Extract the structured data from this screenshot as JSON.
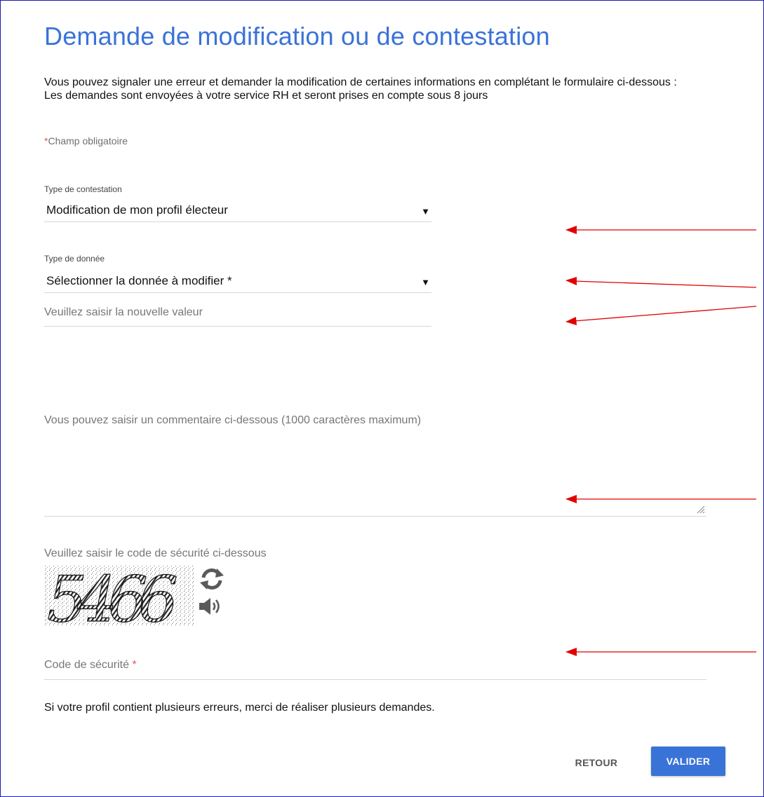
{
  "page": {
    "title": "Demande de modification ou de contestation",
    "intro_line1": "Vous pouvez signaler une erreur et demander la modification de certaines informations en complétant le formulaire ci-dessous :",
    "intro_line2": "Les demandes sont envoyées à votre service RH et seront prises en compte sous 8 jours",
    "required_star": "*",
    "required_note": "Champ obligatoire"
  },
  "form": {
    "contestation_type": {
      "label": "Type de contestation",
      "value": "Modification de mon profil électeur",
      "caret": "▼"
    },
    "data_type": {
      "label": "Type de donnée",
      "value": "Sélectionner la donnée à modifier *",
      "caret": "▼"
    },
    "new_value": {
      "placeholder": "Veuillez saisir la nouvelle valeur"
    },
    "comment": {
      "placeholder": "Vous pouvez saisir un commentaire ci-dessous (1000 caractères maximum)"
    },
    "captcha": {
      "label": "Veuillez saisir le code de sécurité ci-dessous",
      "code_text": "5466",
      "refresh_icon": "refresh-icon",
      "audio_icon": "speaker-icon"
    },
    "security_code": {
      "placeholder": "Code de sécurité",
      "required_star": "*"
    }
  },
  "footer_note": "Si votre profil contient plusieurs erreurs, merci de réaliser plusieurs demandes.",
  "buttons": {
    "back": "RETOUR",
    "submit": "VALIDER"
  },
  "colors": {
    "title": "#3a73d8",
    "primary_button": "#3a73d8",
    "required_star": "#e05a5a",
    "annotation_arrow": "#e00000",
    "frame_border": "#1a1ab0"
  }
}
